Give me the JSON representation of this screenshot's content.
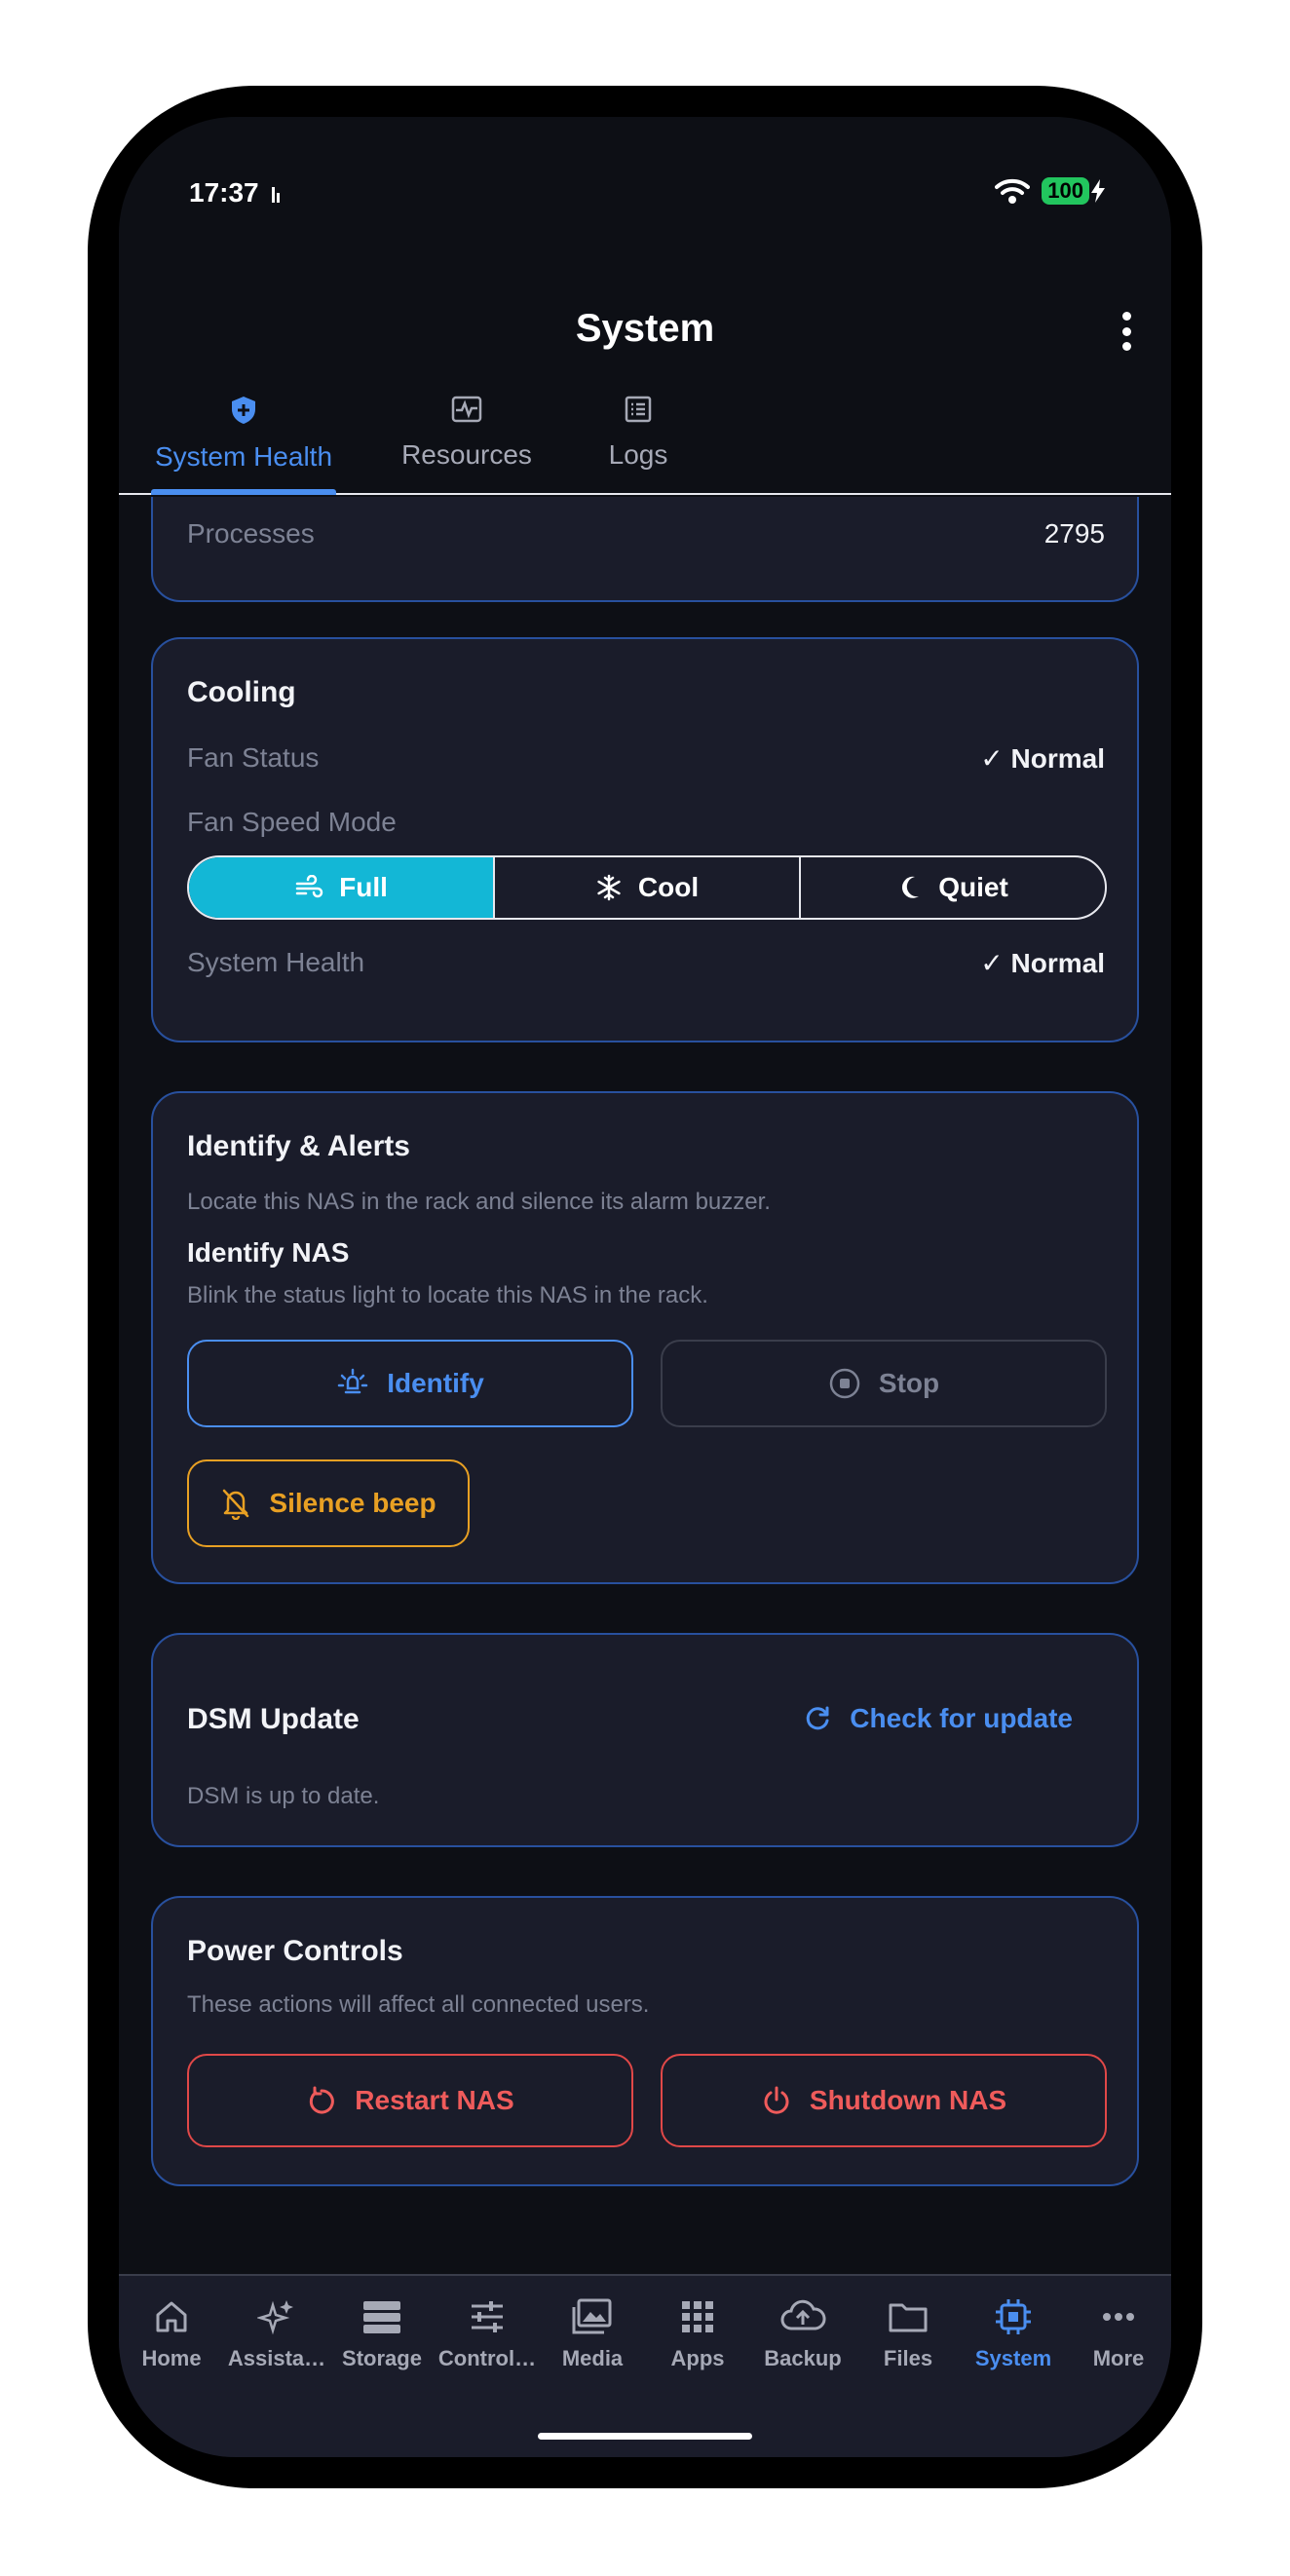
{
  "status_bar": {
    "time": "17:37",
    "battery": "100"
  },
  "header": {
    "title": "System",
    "menu_icon": "kebab-icon"
  },
  "tabs": [
    {
      "label": "System Health",
      "icon": "shield-plus-icon",
      "active": true
    },
    {
      "label": "Resources",
      "icon": "pulse-chart-icon",
      "active": false
    },
    {
      "label": "Logs",
      "icon": "list-icon",
      "active": false
    }
  ],
  "processes": {
    "label": "Processes",
    "value": "2795"
  },
  "cooling": {
    "title": "Cooling",
    "fan_status_label": "Fan Status",
    "fan_status_value": "✓ Normal",
    "fan_speed_mode_label": "Fan Speed Mode",
    "modes": [
      {
        "label": "Full",
        "icon": "wind-icon",
        "selected": true
      },
      {
        "label": "Cool",
        "icon": "snowflake-icon",
        "selected": false
      },
      {
        "label": "Quiet",
        "icon": "moon-icon",
        "selected": false
      }
    ],
    "system_health_label": "System Health",
    "system_health_value": "✓ Normal"
  },
  "identify": {
    "title": "Identify & Alerts",
    "description": "Locate this NAS in the rack and silence its alarm buzzer.",
    "identify_title": "Identify NAS",
    "identify_description": "Blink the status light to locate this NAS in the rack.",
    "identify_button": "Identify",
    "stop_button": "Stop",
    "silence_button": "Silence beep"
  },
  "dsm_update": {
    "title": "DSM Update",
    "check_button": "Check for update",
    "status": "DSM is up to date."
  },
  "power": {
    "title": "Power Controls",
    "description": "These actions will affect all connected users.",
    "restart_button": "Restart NAS",
    "shutdown_button": "Shutdown NAS"
  },
  "bottom_nav": [
    {
      "label": "Home",
      "icon": "home-icon"
    },
    {
      "label": "Assista…",
      "icon": "sparkles-icon"
    },
    {
      "label": "Storage",
      "icon": "storage-icon"
    },
    {
      "label": "Control…",
      "icon": "sliders-icon"
    },
    {
      "label": "Media",
      "icon": "media-icon"
    },
    {
      "label": "Apps",
      "icon": "apps-grid-icon"
    },
    {
      "label": "Backup",
      "icon": "cloud-upload-icon"
    },
    {
      "label": "Files",
      "icon": "folder-icon"
    },
    {
      "label": "System",
      "icon": "cpu-icon",
      "active": true
    },
    {
      "label": "More",
      "icon": "more-icon"
    }
  ],
  "colors": {
    "accent": "#4a8ef0",
    "selected_mode": "#13b7d6",
    "warning": "#e8a023",
    "danger": "#e04848",
    "card_border": "#28509e"
  }
}
